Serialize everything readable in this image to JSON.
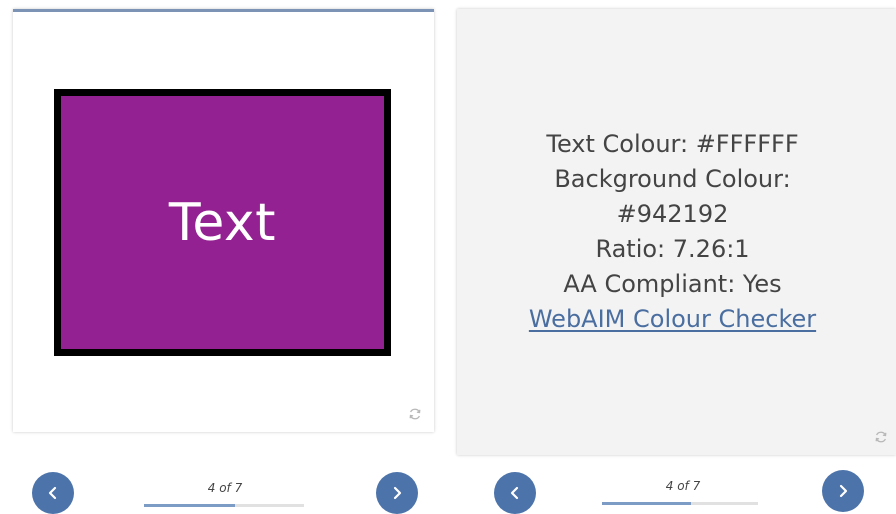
{
  "front_card": {
    "sample_text": "Text",
    "sample_text_color": "#FFFFFF",
    "sample_background": "#942192",
    "flip_icon": "flip-icon"
  },
  "back_card": {
    "lines": [
      "Text Colour: #FFFFFF",
      "Background Colour:",
      "#942192",
      "Ratio: 7.26:1",
      "AA Compliant: Yes"
    ],
    "link_label": "WebAIM Colour Checker",
    "flip_icon": "flip-icon"
  },
  "navigation": [
    {
      "counter": "4 of 7",
      "progress": 0.57
    },
    {
      "counter": "4 of 7",
      "progress": 0.57
    }
  ],
  "icons": {
    "prev": "chevron-left-icon",
    "next": "chevron-right-icon"
  },
  "colors": {
    "accent": "#4c73aa",
    "card_top_border": "#7c93b5",
    "link": "#4a6ea0"
  }
}
